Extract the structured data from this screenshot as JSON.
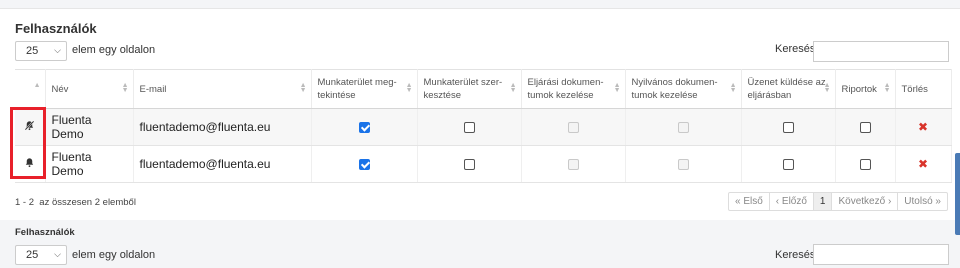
{
  "section": {
    "title": "Felhasználók",
    "page_length": "25",
    "page_length_label": "elem egy oldalon",
    "search_label": "Keresés"
  },
  "table": {
    "headers": [
      "Név",
      "E-mail",
      "Munkaterület meg-tekintése",
      "Munkaterület szer-kesztése",
      "Eljárási dokumen-tumok kezelése",
      "Nyilvános dokumen-tumok kezelése",
      "Üzenet küldése az eljárásban",
      "Riportok",
      "Törlés"
    ],
    "rows": [
      {
        "icon": "bell-off-icon",
        "name": "Fluenta Demo",
        "email": "fluentademo@fluenta.eu",
        "view_workspace": true,
        "edit_workspace": false,
        "procedure_docs": "disabled",
        "public_docs": "disabled",
        "send_message": false,
        "reports": false,
        "delete": "✖"
      },
      {
        "icon": "bell-icon",
        "name": "Fluenta Demo",
        "email": "fluentademo@fluenta.eu",
        "view_workspace": true,
        "edit_workspace": false,
        "procedure_docs": "disabled",
        "public_docs": "disabled",
        "send_message": false,
        "reports": false,
        "delete": "✖"
      }
    ]
  },
  "footer": {
    "info": "1 - 2  az összesen 2 elemből",
    "pager": {
      "first": "« Első",
      "prev": "‹ Előző",
      "current": "1",
      "next": "Következő ›",
      "last": "Utolsó »"
    }
  },
  "section2": {
    "title": "Felhasználók",
    "page_length": "25",
    "page_length_label": "elem egy oldalon",
    "search_label": "Keresés"
  },
  "colors": {
    "highlight": "#e8202a",
    "checkbox_checked": "#1a73e8",
    "delete_icon": "#d9342b"
  }
}
